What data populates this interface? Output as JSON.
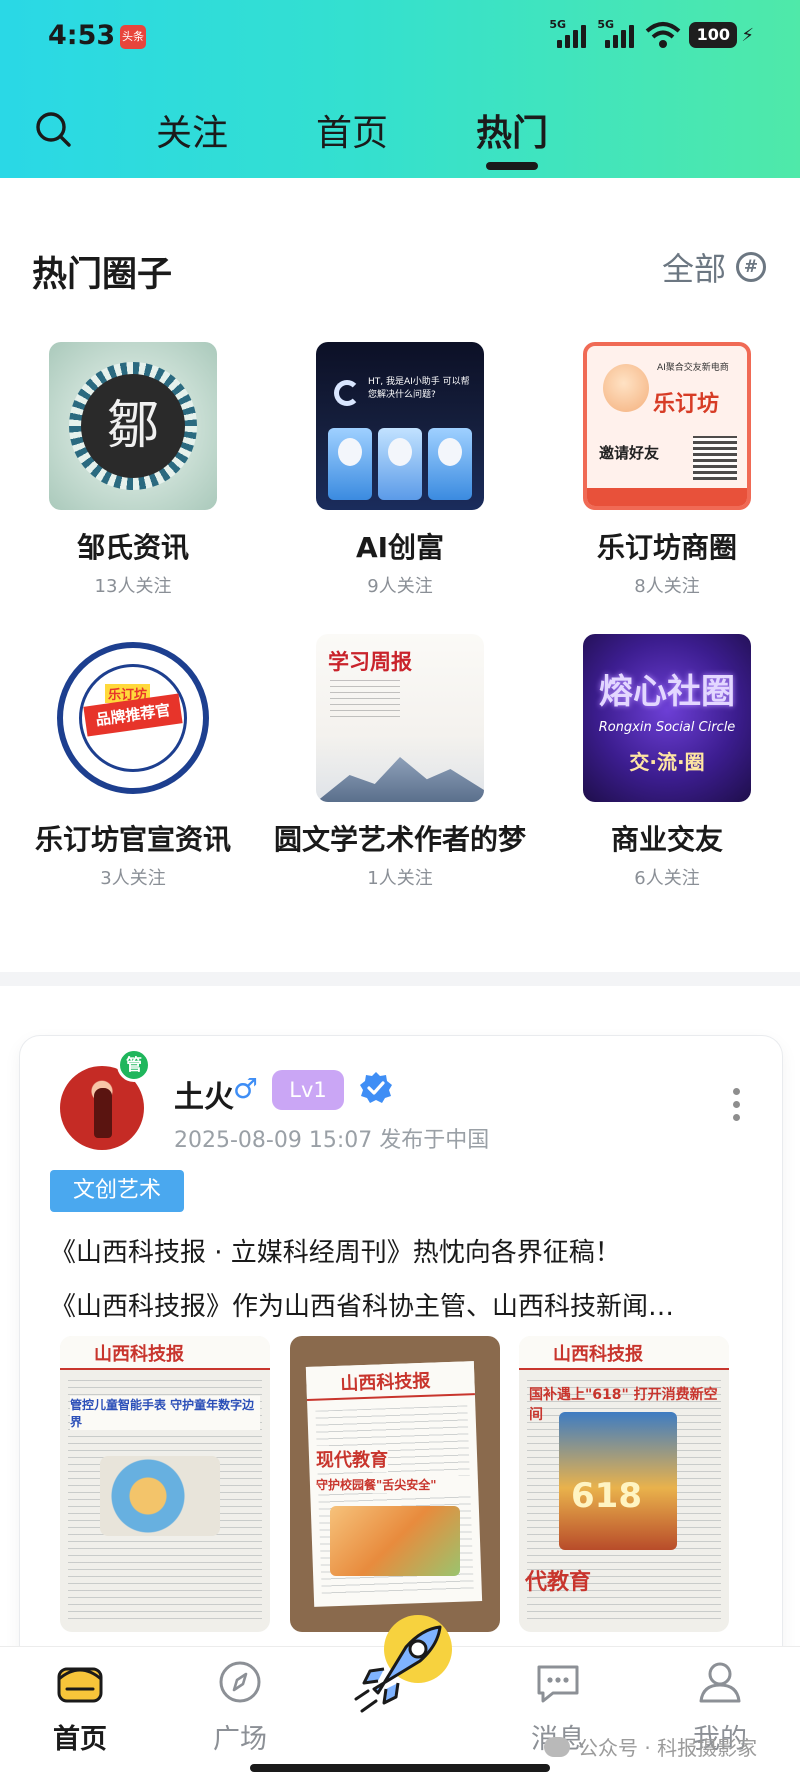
{
  "status_bar": {
    "time": "4:53",
    "app_badge": "头条",
    "network_1": "5G",
    "network_2": "5G",
    "battery": "100"
  },
  "top_tabs": {
    "follow": "关注",
    "home": "首页",
    "hot": "热门",
    "active": "热门"
  },
  "hot_circles": {
    "title": "热门圈子",
    "all_label": "全部",
    "items": [
      {
        "name": "邹氏资讯",
        "followers": "13人关注",
        "thumb_text": "鄒"
      },
      {
        "name": "AI创富",
        "followers": "9人关注",
        "thumb_text": "HT, 我是AI小助手 可以帮您解决什么问题?"
      },
      {
        "name": "乐订坊商圈",
        "followers": "8人关注",
        "thumb_text": "乐订坊",
        "thumb_sub": "AI聚合交友新电商",
        "thumb_invite": "邀请好友"
      },
      {
        "name": "乐订坊官宣资讯",
        "followers": "3人关注",
        "thumb_text": "乐订坊",
        "thumb_sub": "品牌推荐官"
      },
      {
        "name": "圆文学艺术作者的梦",
        "followers": "1人关注",
        "thumb_text": "学习周报"
      },
      {
        "name": "商业交友",
        "followers": "6人关注",
        "thumb_text": "熔心社圈",
        "thumb_sub": "Rongxin Social Circle",
        "thumb_line": "交·流·圈"
      }
    ]
  },
  "post": {
    "admin_badge": "管",
    "username": "土火",
    "gender_symbol": "♂",
    "level": "Lv1",
    "time_location": "2025-08-09 15:07 发布于中国",
    "tag": "文创艺术",
    "line1": "《山西科技报 · 立媒科经周刊》热忱向各界征稿！",
    "line2": "《山西科技报》作为山西省科协主管、山西科技新闻…",
    "photos": [
      {
        "paper_name": "山西科技报",
        "headline": "管控儿童智能手表  守护童年数字边界"
      },
      {
        "paper_name": "山西科技报",
        "headline": "现代教育",
        "sub": "守护校园餐\"舌尖安全\""
      },
      {
        "paper_name": "山西科技报",
        "headline": "国补遇上\"618\" 打开消费新空间",
        "big": "618",
        "edu": "代教育"
      }
    ]
  },
  "bottom_nav": {
    "home": "首页",
    "square": "广场",
    "messages": "消息",
    "me": "我的",
    "active": "首页"
  },
  "watermark": "公众号 · 科报摄影家",
  "colors": {
    "header_start": "#2ad8e6",
    "header_end": "#4fe9a9",
    "tag_blue": "#4aa8ef",
    "level_purple": "#caa6f5",
    "admin_green": "#1fb65c",
    "verified_blue": "#3f8ef5"
  },
  "icons": [
    "search-icon",
    "hash-icon",
    "verified-icon",
    "more-vertical-icon",
    "home-icon",
    "compass-icon",
    "rocket-icon",
    "message-icon",
    "user-icon"
  ]
}
